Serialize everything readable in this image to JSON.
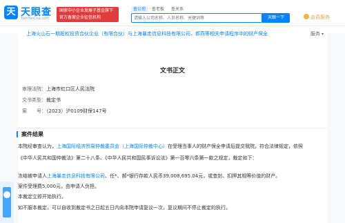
{
  "header": {
    "logo_mark": "天",
    "logo_text": "天眼查",
    "logo_sub": "TianYanCha.com",
    "badge_line1": "国家中小企业发展子基金旗下",
    "badge_line2": "官方备案企业征信机构",
    "tabs": [
      {
        "label": "查公司"
      },
      {
        "label": "查老板"
      },
      {
        "label": "查关系"
      }
    ],
    "active_tab": "查公司",
    "search_placeholder": "请输入公司名称、人员名称、关键词等",
    "search_button": "天眼一下",
    "member_label": "会员服务"
  },
  "page": {
    "doc_title": "上海火山石一期股权投资合伙企业（有限合伙）与上海暴走信息科技有限公司、郝燕等相关申请程序中的财产保全",
    "service_label": "服务"
  },
  "document": {
    "section_title": "文书正文",
    "court_label": "审理法院：",
    "court_value": "上海市虹口区人民法院",
    "type_label": "文书类型：",
    "type_value": "裁定书",
    "case_label": "案　　号：",
    "case_value": "（2023）沪0109财保147号",
    "result_heading": "案件结果",
    "para1_prefix": "本院经审查认为，",
    "para1_link": "上海国际经济贸易仲裁委员会（上海国际仲裁中心）",
    "para1_suffix": "在受理当事人的财产保全申请后提交我院，符合法律规定，依照",
    "para2": "《中华人民共和国仲裁法》第二十八条、《中华人民共和国民事诉讼法》第一百零六条第一款之规定，裁定如下：",
    "para3_prefix": "冻结被申请人",
    "para3_link": "上海暴走信息科技有限公司",
    "para3_suffix": "、任*、郝*银行存款人民币39,008,695.04元，或查封、扣押其相等价值的财产。",
    "para4": "案件受理费5,000元，由申请人负担。",
    "para5": "本裁定立即开始执行。",
    "para6": "如不服本裁定，可以自收到裁定书之日起五日内向本院申请复议一次，复议期间不停止裁定的执行。"
  },
  "colors": {
    "brand": "#0084ff",
    "badge": "#e23b3b",
    "member": "#e6a23c"
  },
  "icons": {
    "logo": "tianyancha-logo-icon",
    "member": "crown-icon",
    "side": "assistant-icon"
  }
}
